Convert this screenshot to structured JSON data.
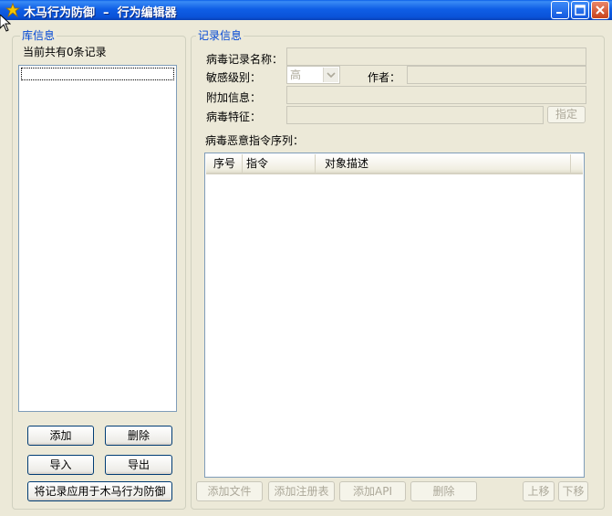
{
  "window": {
    "title": "木马行为防御  –  行为编辑器"
  },
  "library": {
    "legend": "库信息",
    "count_text": "当前共有0条记录",
    "buttons": {
      "add": "添加",
      "delete": "删除",
      "import": "导入",
      "export": "导出",
      "apply": "将记录应用于木马行为防御"
    }
  },
  "record": {
    "legend": "记录信息",
    "name_label": "病毒记录名称：",
    "name_value": "",
    "level_label": "敏感级别：",
    "level_value": "高",
    "author_label": "作者：",
    "author_value": "",
    "extra_label": "附加信息：",
    "extra_value": "",
    "signature_label": "病毒特征：",
    "signature_value": "",
    "specify_button": "指定",
    "sequence_label": "病毒恶意指令序列：",
    "columns": [
      "序号",
      "指令",
      "对象描述"
    ],
    "rows": [],
    "buttons": {
      "add_file": "添加文件",
      "add_registry": "添加注册表",
      "add_api": "添加API",
      "delete": "删除",
      "move_up": "上移",
      "move_down": "下移"
    }
  }
}
